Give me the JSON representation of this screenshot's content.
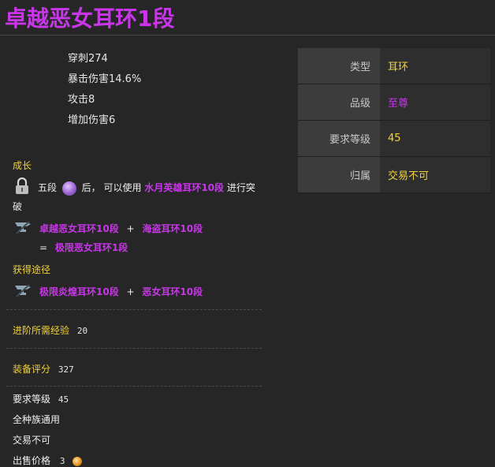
{
  "title": "卓越恶女耳环1段",
  "stats": [
    "穿刺274",
    "暴击伤害14.6%",
    "攻击8",
    "增加伤害6"
  ],
  "attributes": [
    {
      "key": "类型",
      "value": "耳环",
      "color": "#f2d23a"
    },
    {
      "key": "品级",
      "value": "至尊",
      "color": "#c936e9"
    },
    {
      "key": "要求等级",
      "value": "45",
      "color": "#f2d23a"
    },
    {
      "key": "归属",
      "value": "交易不可",
      "color": "#f2d23a"
    }
  ],
  "growth": {
    "title": "成长",
    "breakthrough": {
      "prefix": "五段",
      "middle": "后，  可以使用",
      "item": "水月英雄耳环10段",
      "suffix": "进行突",
      "wrap": "破"
    },
    "combine": {
      "a": "卓越恶女耳环10段",
      "plus": "+",
      "b": "海盗耳环10段",
      "eq": "=",
      "result": "极限恶女耳环1段"
    }
  },
  "obtain": {
    "title": "获得途径",
    "a": "极限炎煌耳环10段",
    "plus": "+",
    "b": "恶女耳环10段"
  },
  "exp": {
    "label": "进阶所需经验",
    "value": "20"
  },
  "score": {
    "label": "装备评分",
    "value": "327"
  },
  "footer": {
    "level_label": "要求等级",
    "level_value": "45",
    "race": "全种族通用",
    "trade": "交易不可",
    "price_label": "出售价格",
    "price_value": "3"
  }
}
